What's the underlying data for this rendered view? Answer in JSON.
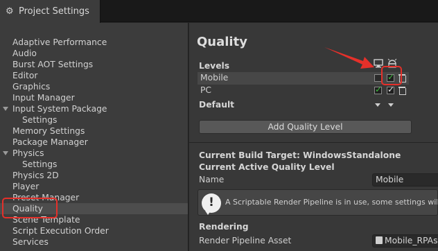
{
  "window": {
    "tab_title": "Project Settings",
    "tab_icon": "gear-icon"
  },
  "sidebar": {
    "items": [
      {
        "label": "Adaptive Performance"
      },
      {
        "label": "Audio"
      },
      {
        "label": "Burst AOT Settings"
      },
      {
        "label": "Editor"
      },
      {
        "label": "Graphics"
      },
      {
        "label": "Input Manager"
      },
      {
        "label": "Input System Package"
      },
      {
        "label": "Settings"
      },
      {
        "label": "Memory Settings"
      },
      {
        "label": "Package Manager"
      },
      {
        "label": "Physics"
      },
      {
        "label": "Settings"
      },
      {
        "label": "Physics 2D"
      },
      {
        "label": "Player"
      },
      {
        "label": "Preset Manager"
      },
      {
        "label": "Quality"
      },
      {
        "label": "Scene Template"
      },
      {
        "label": "Script Execution Order"
      },
      {
        "label": "Services"
      }
    ],
    "selected": "Quality"
  },
  "main": {
    "title": "Quality",
    "levels": {
      "label": "Levels",
      "rows": [
        {
          "name": "Mobile",
          "standalone": false,
          "android": true
        },
        {
          "name": "PC",
          "standalone": true,
          "android": true
        }
      ],
      "default_label": "Default"
    },
    "add_button": "Add Quality Level",
    "build_target": "Current Build Target: WindowsStandalone",
    "active_level": "Current Active Quality Level",
    "name_label": "Name",
    "name_value": "Mobile",
    "help_text": "A Scriptable Render Pipeline is in use, some settings will not be used",
    "rendering_label": "Rendering",
    "pipeline_label": "Render Pipeline Asset",
    "pipeline_value": "Mobile_RPAsset"
  },
  "colors": {
    "highlight": "#e5302a",
    "check": "#3fbf3f"
  }
}
